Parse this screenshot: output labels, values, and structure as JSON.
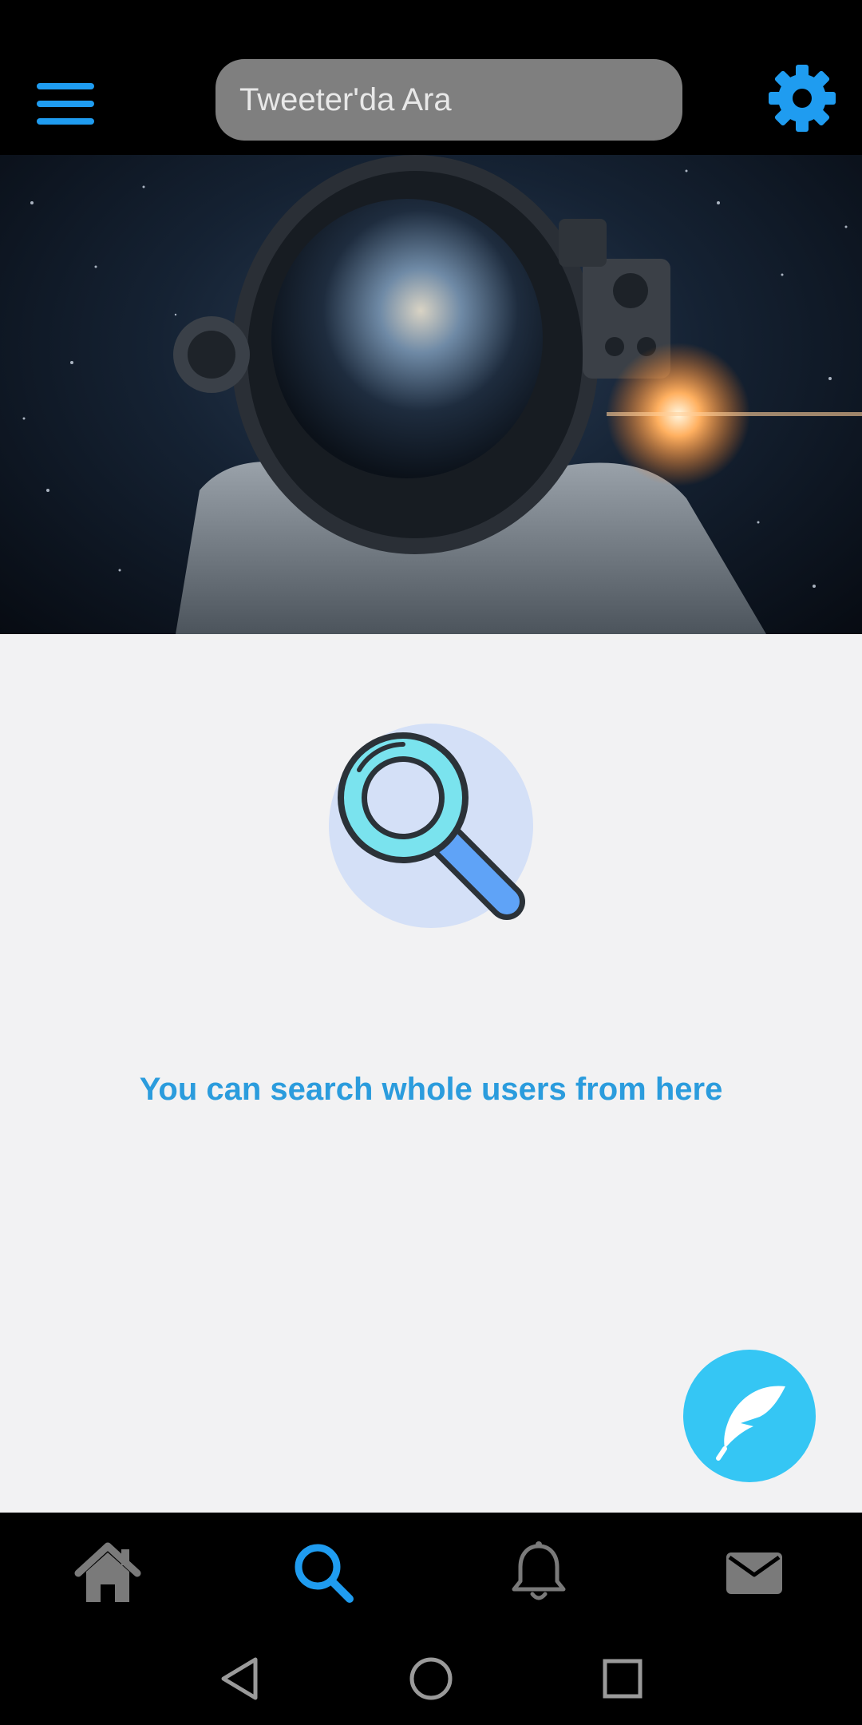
{
  "header": {
    "menu_icon": "hamburger-menu-icon",
    "search_placeholder": "Tweeter'da Ara",
    "settings_icon": "gear-icon",
    "accent_color": "#1f9cf0"
  },
  "banner": {
    "description_icon": "astronaut-space-banner"
  },
  "main": {
    "illustration_icon": "magnifier-icon",
    "empty_message": "You can search whole users from here",
    "empty_message_color": "#2b9cdd"
  },
  "fab": {
    "icon": "feather-compose-icon",
    "color": "#35c6f4"
  },
  "bottom_nav": {
    "items": [
      {
        "icon": "home-icon",
        "active": false
      },
      {
        "icon": "search-icon",
        "active": true
      },
      {
        "icon": "bell-icon",
        "active": false
      },
      {
        "icon": "mail-icon",
        "active": false
      }
    ],
    "active_color": "#1f9cf0",
    "inactive_color": "#7a7a7a"
  },
  "system_nav": {
    "items": [
      "back-icon",
      "home-circle-icon",
      "recents-icon"
    ]
  }
}
